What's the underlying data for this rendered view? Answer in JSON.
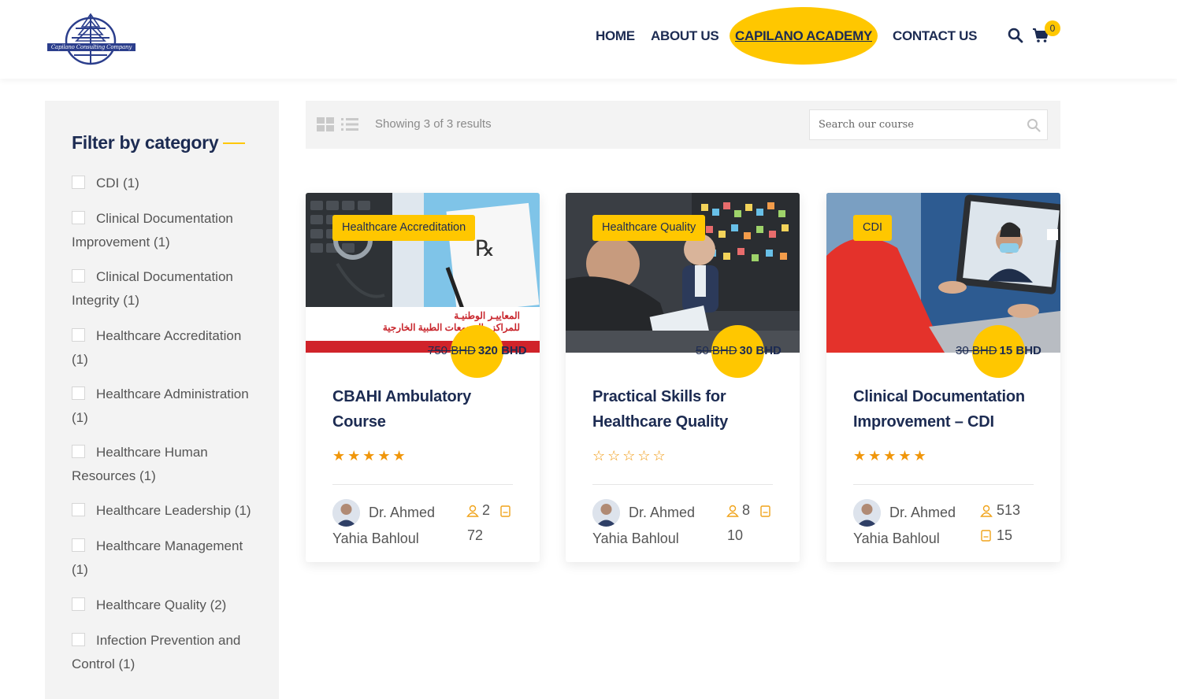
{
  "header": {
    "logo_text": "Capilano Consulting Company",
    "nav": {
      "home": "HOME",
      "about": "ABOUT US",
      "academy": "CAPILANO ACADEMY",
      "contact": "CONTACT US"
    },
    "cart_count": "0",
    "accent_color": "#ffc700",
    "brand_color": "#1c2b52"
  },
  "sidebar": {
    "title": "Filter by category",
    "categories": [
      "CDI (1)",
      "Clinical Documentation Improvement (1)",
      "Clinical Documentation Integrity (1)",
      "Healthcare Accreditation (1)",
      "Healthcare Administration (1)",
      "Healthcare Human Resources (1)",
      "Healthcare Leadership (1)",
      "Healthcare Management (1)",
      "Healthcare Quality (2)",
      "Infection Prevention and Control (1)"
    ]
  },
  "toolbar": {
    "showing": "Showing 3 of 3 results",
    "search_placeholder": "Search our course"
  },
  "courses": [
    {
      "category": "Healthcare Accreditation",
      "old_price": "750 BHD",
      "price": "320 BHD",
      "title": "CBAHI Ambulatory Course",
      "rating": 5,
      "stars": "★★★★★",
      "instructor": "Dr. Ahmed Yahia Bahloul",
      "students": "2",
      "lessons": "72",
      "image_text_1": "المعاييـر الوطنيـة",
      "image_text_2": "للمراكز والمجمعات الطبية الخارجية"
    },
    {
      "category": "Healthcare Quality",
      "old_price": "50 BHD",
      "price": "30 BHD",
      "title": "Practical Skills for Healthcare Quality",
      "rating": 0,
      "stars": "☆☆☆☆☆",
      "instructor": "Dr. Ahmed Yahia Bahloul",
      "students": "8",
      "lessons": "10"
    },
    {
      "category": "CDI",
      "old_price": "30 BHD",
      "price": "15 BHD",
      "title": "Clinical Documentation Improvement – CDI",
      "rating": 5,
      "stars": "★★★★★",
      "instructor": "Dr. Ahmed Yahia Bahloul",
      "students": "513",
      "lessons": "15"
    }
  ]
}
